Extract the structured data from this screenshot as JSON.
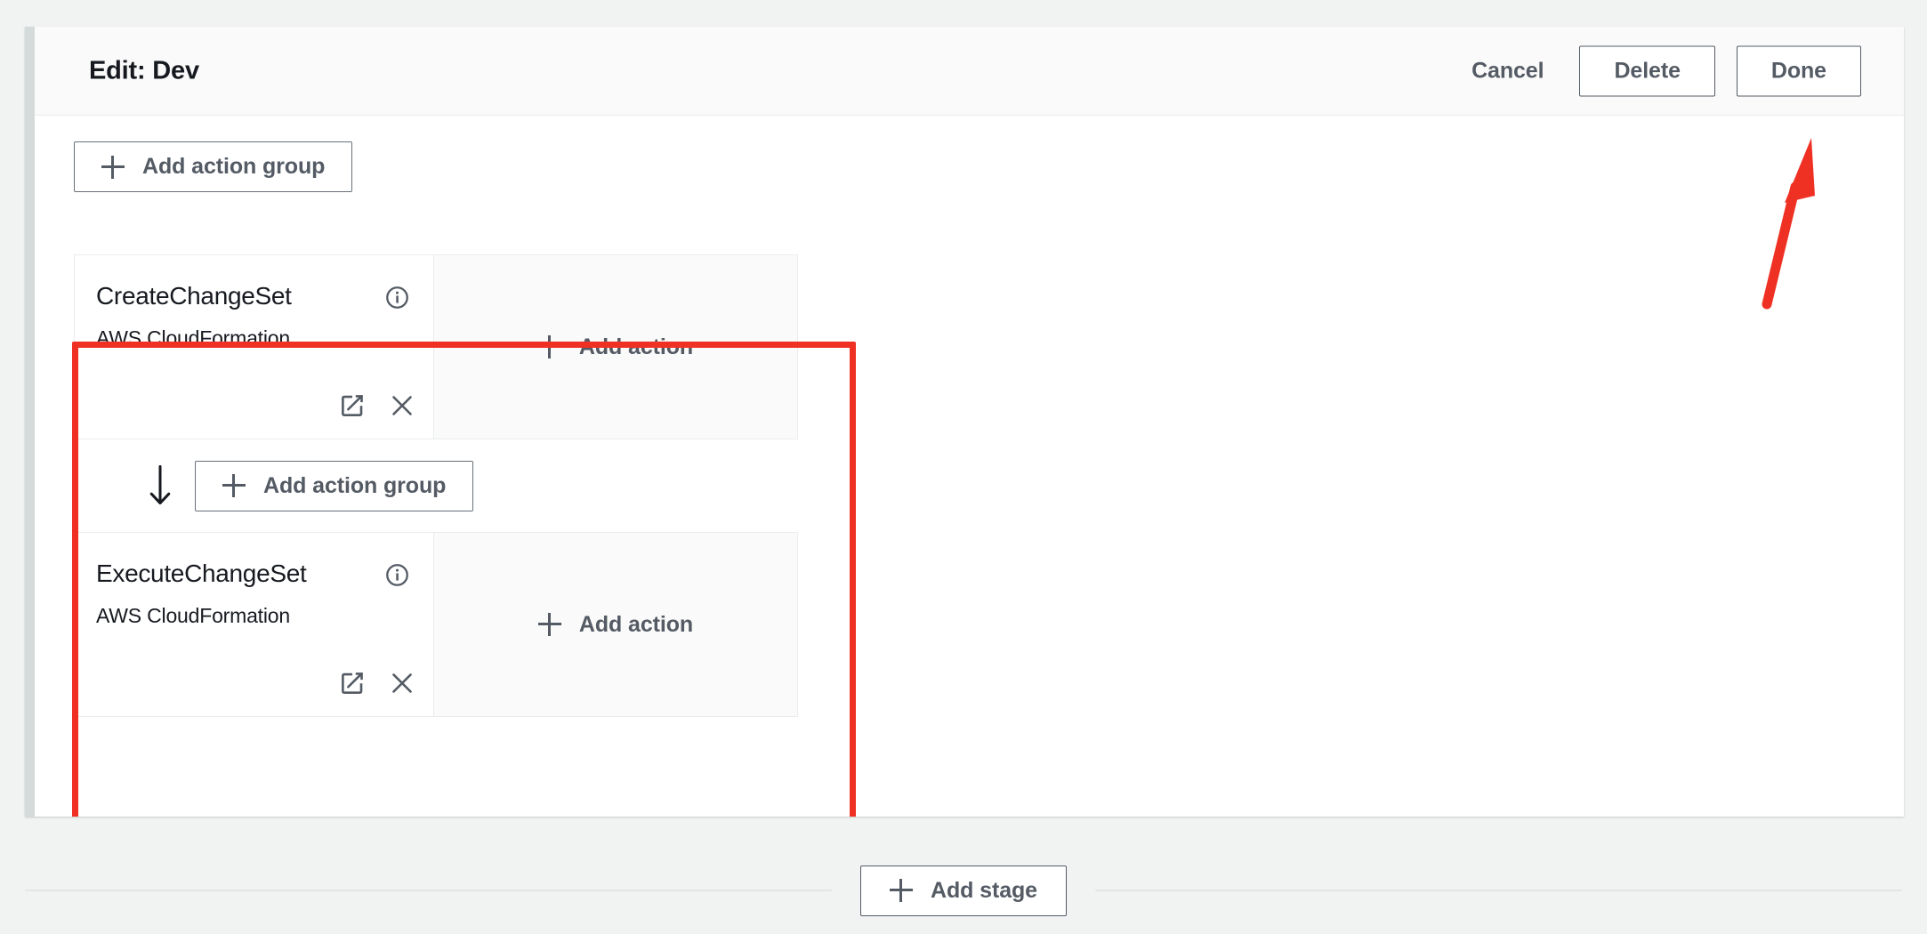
{
  "stage_editor": {
    "title": "Edit: Dev",
    "header_buttons": {
      "cancel": "Cancel",
      "delete": "Delete",
      "done": "Done"
    },
    "add_action_group_label": "Add action group",
    "add_action_label": "Add action",
    "action_groups": [
      {
        "name": "CreateChangeSet",
        "provider": "AWS CloudFormation",
        "info_icon": "info-circle-icon",
        "edit_icon": "edit-pencil-icon",
        "remove_icon": "close-x-icon",
        "add_action_label": "Add action"
      },
      {
        "name": "ExecuteChangeSet",
        "provider": "AWS CloudFormation",
        "info_icon": "info-circle-icon",
        "edit_icon": "edit-pencil-icon",
        "remove_icon": "close-x-icon",
        "add_action_label": "Add action"
      }
    ],
    "between_groups": {
      "arrow_icon": "arrow-down-icon",
      "add_action_group_label": "Add action group"
    }
  },
  "footer": {
    "add_stage_label": "Add stage"
  },
  "annotations": {
    "highlight_color": "#ef3124",
    "arrow_color": "#ef3124",
    "arrow_icon": "arrow-up-pointer",
    "highlight_target": "action-group-stack",
    "arrow_target": "done-button"
  },
  "colors": {
    "page_background": "#f1f3f3",
    "panel_background": "#ffffff",
    "header_background": "#fafafa",
    "rail": "#d5dbdb",
    "border": "#eaeded",
    "text_primary": "#16191f",
    "text_secondary": "#545b64",
    "add_action_zone": "#fafafa"
  }
}
